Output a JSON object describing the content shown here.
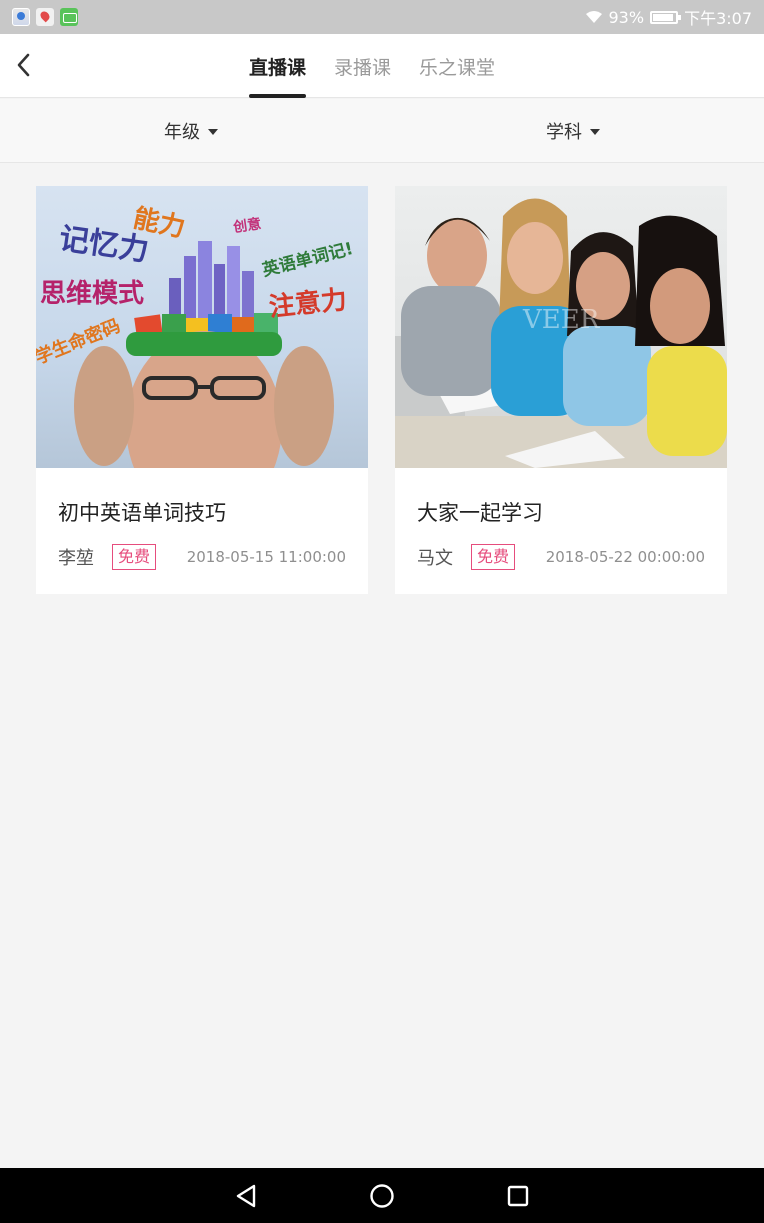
{
  "status_bar": {
    "battery": "93%",
    "battery_level": 0.93,
    "time": "下午3:07",
    "app_icons": [
      "video-app-icon",
      "maps-app-icon",
      "messaging-app-icon"
    ]
  },
  "header": {
    "tabs": [
      {
        "label": "直播课",
        "active": true
      },
      {
        "label": "录播课",
        "active": false
      },
      {
        "label": "乐之课堂",
        "active": false
      }
    ]
  },
  "filters": [
    {
      "label": "年级"
    },
    {
      "label": "学科"
    }
  ],
  "courses": [
    {
      "title": "初中英语单词技巧",
      "teacher": "李堃",
      "price_tag": "免费",
      "datetime": "2018-05-15 11:00:00",
      "image_words": [
        "记忆力",
        "能力",
        "创意",
        "英语单词记!",
        "思维模式",
        "注意力",
        "学生命密码"
      ]
    },
    {
      "title": "大家一起学习",
      "teacher": "马文",
      "price_tag": "免费",
      "datetime": "2018-05-22 00:00:00",
      "image_watermark": "VEER"
    }
  ],
  "colors": {
    "accent": "#e64d7d",
    "status_bar": "#c8c8c8",
    "nav_bar": "#000000",
    "background": "#f4f4f4"
  }
}
